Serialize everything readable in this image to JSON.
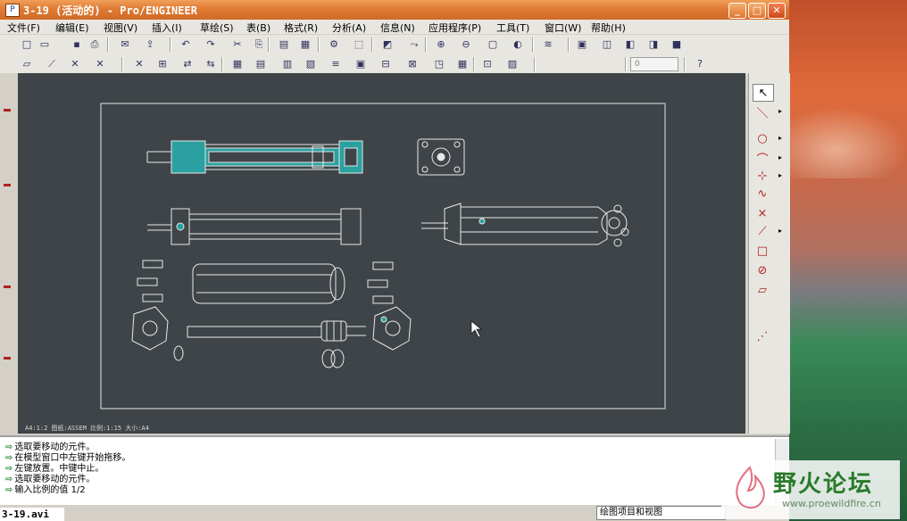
{
  "window": {
    "title": "3-19 (活动的) - Pro/ENGINEER",
    "buttons": {
      "minimize": "_",
      "maximize": "□",
      "close": "✕"
    }
  },
  "menu": [
    "文件(F)",
    "编辑(E)",
    "视图(V)",
    "插入(I)",
    "草绘(S)",
    "表(B)",
    "格式(R)",
    "分析(A)",
    "信息(N)",
    "应用程序(P)",
    "工具(T)",
    "窗口(W)",
    "帮助(H)"
  ],
  "toolbar1": {
    "icons": [
      "new-icon",
      "open-icon",
      "save-icon",
      "print-icon",
      "email-icon",
      "send-icon",
      "undo-icon",
      "redo-icon",
      "cut-icon",
      "copy-icon",
      "paste-icon",
      "paste-special-icon",
      "regenerate-icon",
      "box-select-icon",
      "sketch-icon",
      "rotate-icon",
      "zoom-in-icon",
      "zoom-out-icon",
      "refit-icon",
      "repaint-icon",
      "layers-icon",
      "view-manager-icon",
      "wireframe-icon",
      "hidden-line-icon",
      "no-hidden-icon",
      "shading-icon"
    ],
    "glyphs": [
      "□",
      "▭",
      "▪",
      "⎙",
      "✉",
      "⇪",
      "↶",
      "↷",
      "✂",
      "⎘",
      "▤",
      "▦",
      "⚙",
      "⬚",
      "◩",
      "⤳",
      "⊕",
      "⊖",
      "▢",
      "◐",
      "≋",
      "▣",
      "◫",
      "◧",
      "◨",
      "■"
    ]
  },
  "toolbar2": {
    "icons": [
      "datum-plane-icon",
      "datum-axis-icon",
      "datum-point-icon",
      "csys-icon",
      "cross-icon",
      "align-icon",
      "move-icon",
      "swap-icon",
      "detail-icon",
      "table-icon",
      "grid-icon",
      "balloon-icon",
      "tolerance-icon",
      "note-icon",
      "symbol-icon",
      "sheet-icon",
      "view-icon",
      "format-icon",
      "scale-icon",
      "snapshot-icon",
      "help-icon"
    ],
    "glyphs": [
      "▱",
      "⟋",
      "✕",
      "✕",
      "✕",
      "⊞",
      "⇄",
      "⇆",
      "▦",
      "▤",
      "▥",
      "▧",
      "≡",
      "▣",
      "⊟",
      "⊠",
      "◳",
      "▦",
      "⊡",
      "▨",
      "?"
    ],
    "scale_value": "0",
    "help_label": "?"
  },
  "drawing_status": "A4:1:2   图纸:ASSEM  比例:1:15  大小:A4",
  "right_tools": [
    "select-icon",
    "line-icon",
    "circle-icon",
    "arc-icon",
    "fillet-icon",
    "spline-icon",
    "point-icon",
    "chamfer-icon",
    "box-icon",
    "offset-icon",
    "datum-plane-icon",
    "datum-axis-icon"
  ],
  "right_glyphs": [
    "↖",
    "＼",
    "○",
    "⌒",
    "⊹",
    "∿",
    "×",
    "⟋",
    "□",
    "⊘",
    "▱",
    "⋰"
  ],
  "messages": [
    "选取要移动的元件。",
    "在模型窗口中左键开始拖移。",
    "左键放置。中键中止。",
    "选取要移动的元件。",
    "输入比例的值     1/2"
  ],
  "status_box": "绘图项目和视图",
  "video_label": "3-19.avi",
  "watermark": {
    "name": "野火论坛",
    "url": "www.proewildfire.cn"
  }
}
